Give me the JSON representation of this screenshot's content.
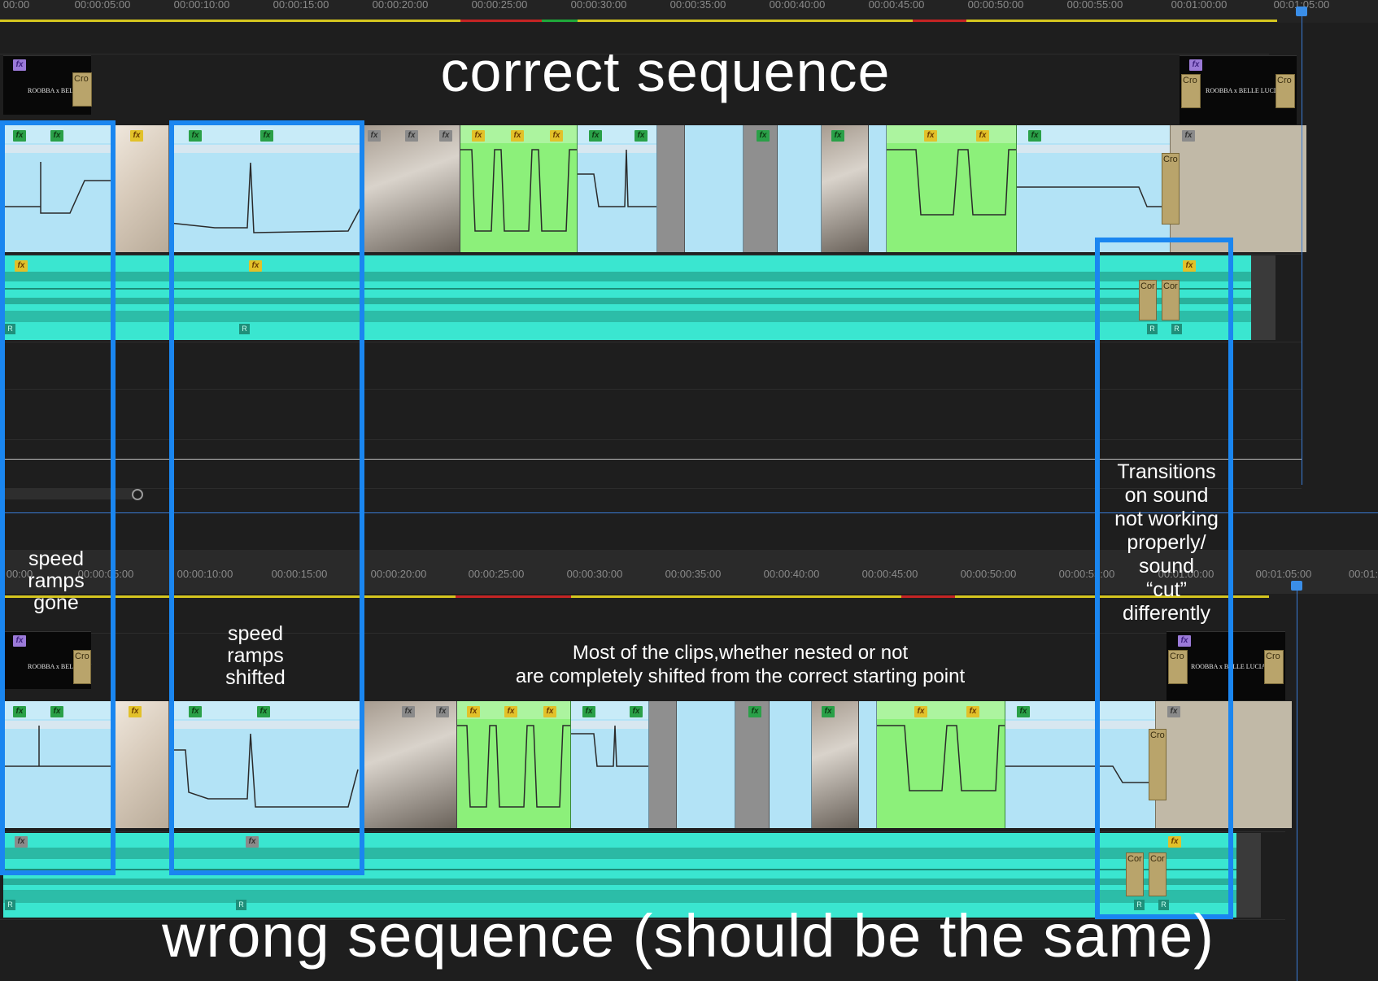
{
  "annotations": {
    "top_title": "correct sequence",
    "bottom_title": "wrong sequence (should be the same)",
    "speed_ramps_gone": [
      "speed",
      "ramps",
      "gone"
    ],
    "speed_ramps_shifted": [
      "speed",
      "ramps",
      "shifted"
    ],
    "clips_shifted": [
      "Most of the clips,whether nested or not",
      "are completely shifted from the correct starting point"
    ],
    "transitions_note": [
      "Transitions",
      "on sound",
      "not working",
      "properly/",
      "sound",
      "“cut”",
      "differently"
    ]
  },
  "top_ruler": {
    "ticks": [
      "00:00",
      "00:00:05:00",
      "00:00:10:00",
      "00:00:15:00",
      "00:00:20:00",
      "00:00:25:00",
      "00:00:30:00",
      "00:00:35:00",
      "00:00:40:00",
      "00:00:45:00",
      "00:00:50:00",
      "00:00:55:00",
      "00:01:00:00",
      "00:01:05:00"
    ]
  },
  "bottom_ruler": {
    "ticks": [
      "00:00",
      "00:00:05:00",
      "00:00:10:00",
      "00:00:15:00",
      "00:00:20:00",
      "00:00:25:00",
      "00:00:30:00",
      "00:00:35:00",
      "00:00:40:00",
      "00:00:45:00",
      "00:00:50:00",
      "00:00:55:00",
      "00:01:00:00",
      "00:01:05:00",
      "00:01:"
    ]
  },
  "title_clip_text": "ROOBBA x BELLE LUCIA",
  "title_clip_text_short": "ROOBBA x BELLE LU",
  "cro_label": "Cro",
  "cor_label": "Cor",
  "fx_label": "fx",
  "r_label": "R",
  "colors": {
    "highlight": "#1a86f0",
    "video_clip": "#b3e3f6",
    "speed_clip": "#8cf07a",
    "audio_clip": "#3ae6d0",
    "work_area": "#d5c61f",
    "playhead": "#3a8ee8"
  }
}
